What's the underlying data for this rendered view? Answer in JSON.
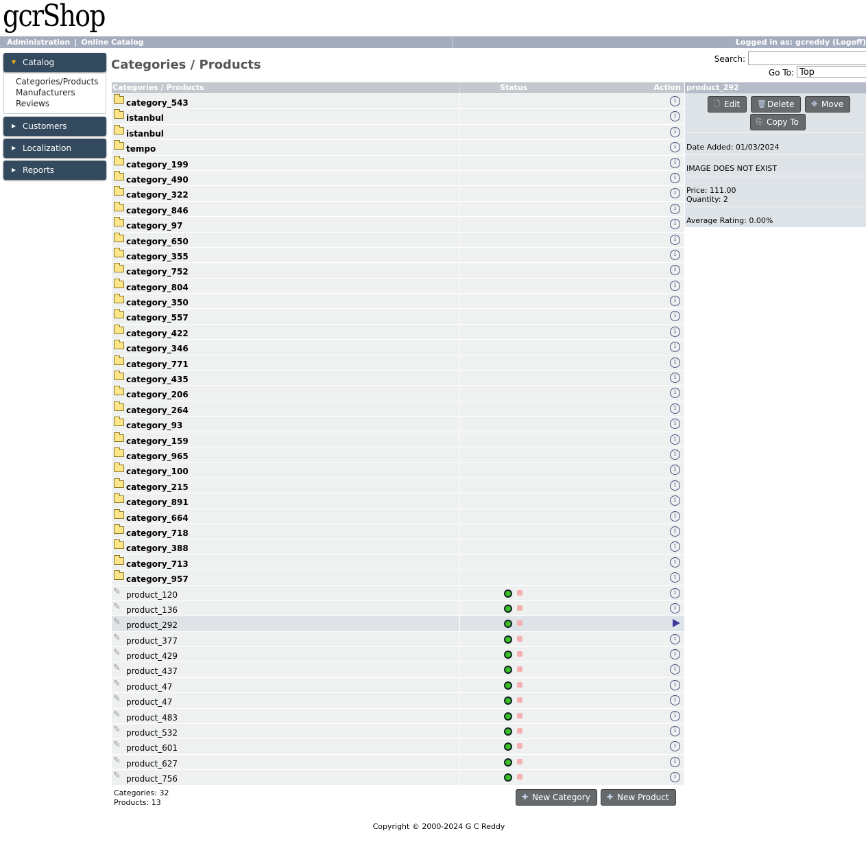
{
  "header": {
    "logo": "gcrShop",
    "nav_admin": "Administration",
    "nav_sep": "|",
    "nav_catalog": "Online Catalog",
    "logged_in": "Logged in as: gcreddy (Logoff)"
  },
  "sidebar": {
    "sections": [
      {
        "label": "Catalog",
        "active": true,
        "items": [
          "Categories/Products",
          "Manufacturers",
          "Reviews"
        ]
      },
      {
        "label": "Customers"
      },
      {
        "label": "Localization"
      },
      {
        "label": "Reports"
      }
    ]
  },
  "page": {
    "title": "Categories / Products",
    "search_label": "Search:",
    "search_value": "",
    "goto_label": "Go To:",
    "goto_value": "Top"
  },
  "table": {
    "headers": [
      "Categories / Products",
      "Status",
      "Action"
    ],
    "categories": [
      "category_543",
      "istanbul",
      "istanbul",
      "tempo",
      "category_199",
      "category_490",
      "category_322",
      "category_846",
      "category_97",
      "category_650",
      "category_355",
      "category_752",
      "category_804",
      "category_350",
      "category_557",
      "category_422",
      "category_346",
      "category_771",
      "category_435",
      "category_206",
      "category_264",
      "category_93",
      "category_159",
      "category_965",
      "category_100",
      "category_215",
      "category_891",
      "category_664",
      "category_718",
      "category_388",
      "category_713",
      "category_957"
    ],
    "products": [
      "product_120",
      "product_136",
      "product_292",
      "product_377",
      "product_429",
      "product_437",
      "product_47",
      "product_47",
      "product_483",
      "product_532",
      "product_601",
      "product_627",
      "product_756"
    ],
    "selected_product": "product_292",
    "counts_categories": "Categories: 32",
    "counts_products": "Products: 13",
    "new_category": "New Category",
    "new_product": "New Product"
  },
  "details": {
    "title": "product_292",
    "edit": "Edit",
    "delete": "Delete",
    "move": "Move",
    "copy_to": "Copy To",
    "date_added": "Date Added: 01/03/2024",
    "image": "IMAGE DOES NOT EXIST",
    "price": "Price: 111.00",
    "quantity": "Quantity: 2",
    "rating": "Average Rating: 0.00%"
  },
  "footer": {
    "copyright": "Copyright © 2000-2024 G C Reddy"
  }
}
